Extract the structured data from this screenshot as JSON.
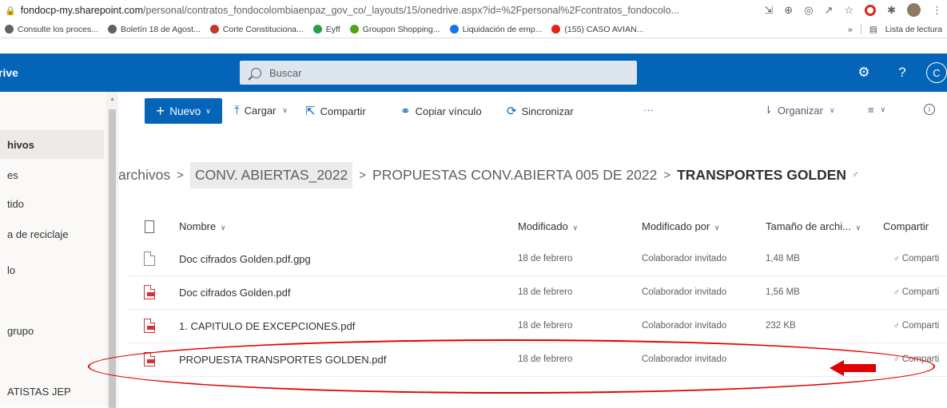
{
  "browser": {
    "url_host": "fondocp-my.sharepoint.com",
    "url_rest": "/personal/contratos_fondocolombiaenpaz_gov_co/_layouts/15/onedrive.aspx?id=%2Fpersonal%2Fcontratos_fondocolo...",
    "bookmarks": [
      {
        "label": "Consulte los proces...",
        "color": "#5f6368"
      },
      {
        "label": "Boletín 18 de Agost...",
        "color": "#5f6368"
      },
      {
        "label": "Corte Constituciona...",
        "color": "#c0392b"
      },
      {
        "label": "Eyff",
        "color": "#25a244"
      },
      {
        "label": "Groupon Shopping...",
        "color": "#53a318"
      },
      {
        "label": "Liquidación de emp...",
        "color": "#1a73e8"
      },
      {
        "label": "(155) CASO AVIAN...",
        "color": "#e62117"
      }
    ],
    "more": "»",
    "reading_list": "Lista de lectura"
  },
  "suite": {
    "app_name": "rive",
    "search_placeholder": "Buscar",
    "me_initial": "C",
    "help": "?"
  },
  "nav": {
    "items": [
      {
        "label": "hivos",
        "selected": true
      },
      {
        "label": "es"
      },
      {
        "label": "tido"
      },
      {
        "label": "a de reciclaje"
      },
      {
        "label": "lo"
      },
      {
        "label": "grupo"
      },
      {
        "label": "ATISTAS JEP"
      }
    ]
  },
  "command_bar": {
    "new": "Nuevo",
    "upload": "Cargar",
    "share": "Compartir",
    "copy_link": "Copiar vínculo",
    "sync": "Sincronizar",
    "more": "···",
    "sort": "Organizar"
  },
  "breadcrumb": {
    "items": [
      "archivos",
      "CONV. ABIERTAS_2022",
      "PROPUESTAS CONV.ABIERTA 005 DE 2022"
    ],
    "current": "TRANSPORTES GOLDEN"
  },
  "table": {
    "columns": {
      "name": "Nombre",
      "modified": "Modificado",
      "modified_by": "Modificado por",
      "size": "Tamaño de archi...",
      "sharing": "Compartir"
    },
    "rows": [
      {
        "name": "Doc cifrados Golden.pdf.gpg",
        "type": "doc",
        "modified": "18 de febrero",
        "modified_by": "Colaborador invitado",
        "size": "1,48 MB",
        "sharing": "Comparti"
      },
      {
        "name": "Doc cifrados Golden.pdf",
        "type": "pdf",
        "modified": "18 de febrero",
        "modified_by": "Colaborador invitado",
        "size": "1,56 MB",
        "sharing": "Comparti"
      },
      {
        "name": "1. CAPITULO DE EXCEPCIONES.pdf",
        "type": "pdf",
        "modified": "18 de febrero",
        "modified_by": "Colaborador invitado",
        "size": "232 KB",
        "sharing": "Comparti"
      },
      {
        "name": "PROPUESTA TRANSPORTES GOLDEN.pdf",
        "type": "pdf",
        "modified": "18 de febrero",
        "modified_by": "Colaborador invitado",
        "size": "",
        "sharing": "Comparti"
      }
    ]
  },
  "annotation": {
    "color": "#e00000"
  }
}
